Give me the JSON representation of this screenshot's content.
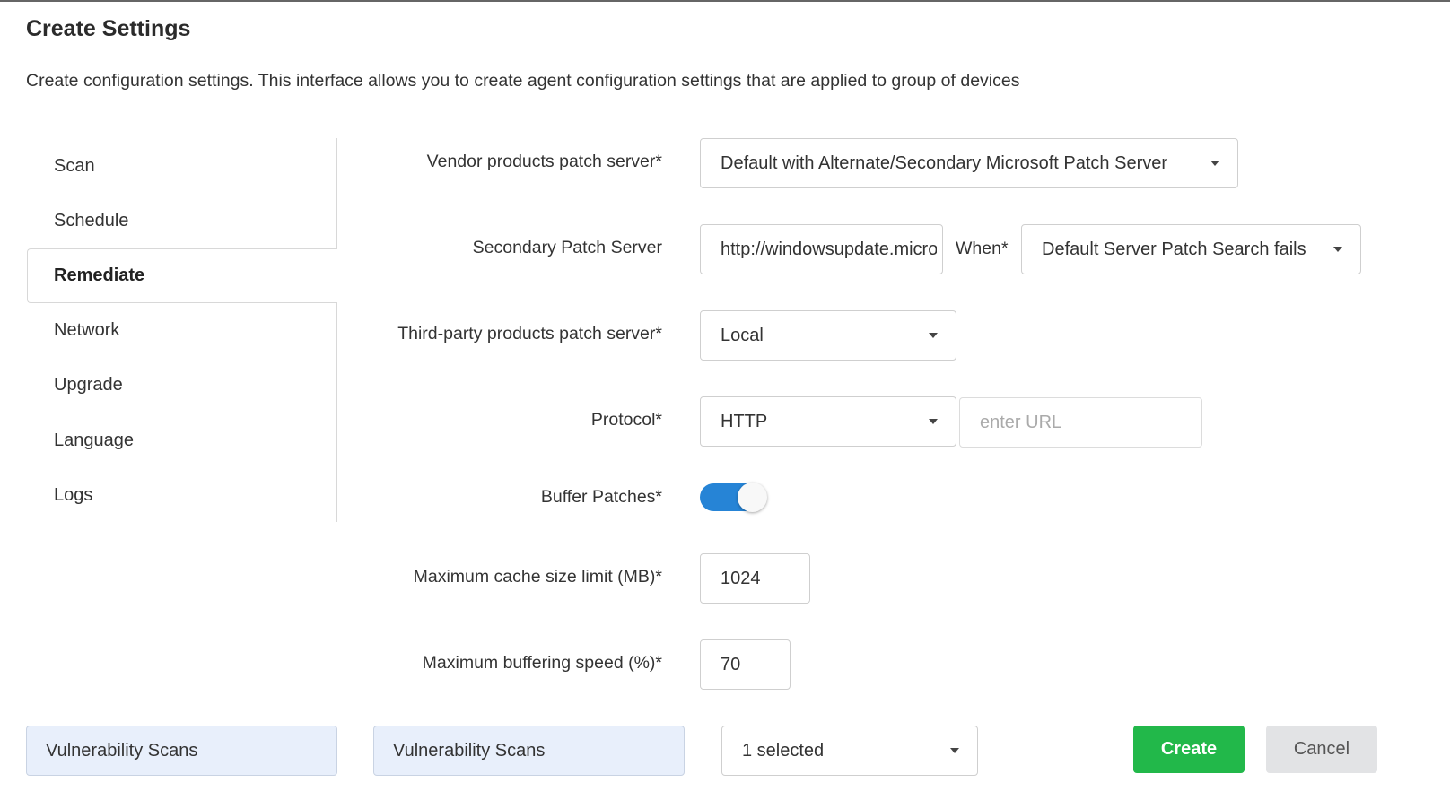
{
  "page": {
    "title": "Create Settings",
    "description": "Create configuration settings. This interface allows you to create agent configuration settings that are applied to group of devices"
  },
  "sidebar": {
    "items": [
      {
        "label": "Scan",
        "active": false
      },
      {
        "label": "Schedule",
        "active": false
      },
      {
        "label": "Remediate",
        "active": true
      },
      {
        "label": "Network",
        "active": false
      },
      {
        "label": "Upgrade",
        "active": false
      },
      {
        "label": "Language",
        "active": false
      },
      {
        "label": "Logs",
        "active": false
      }
    ]
  },
  "form": {
    "vendor_patch_server": {
      "label": "Vendor products patch server*",
      "value": "Default with Alternate/Secondary Microsoft Patch Server"
    },
    "secondary_patch_server": {
      "label": "Secondary Patch Server",
      "value": "http://windowsupdate.microsoft.com",
      "when_label": "When*",
      "when_value": "Default Server Patch Search fails"
    },
    "third_party_patch_server": {
      "label": "Third-party products patch server*",
      "value": "Local"
    },
    "protocol": {
      "label": "Protocol*",
      "value": "HTTP",
      "url_placeholder": "enter URL",
      "url_value": ""
    },
    "buffer_patches": {
      "label": "Buffer Patches*",
      "enabled": true
    },
    "max_cache_size": {
      "label": "Maximum cache size limit (MB)*",
      "value": "1024"
    },
    "max_buffering_speed": {
      "label": "Maximum buffering speed (%)*",
      "value": "70"
    }
  },
  "footer": {
    "chip_1": "Vulnerability Scans",
    "chip_2": "Vulnerability Scans",
    "multi_select": "1 selected",
    "create_label": "Create",
    "cancel_label": "Cancel"
  },
  "colors": {
    "toggle_on": "#2684d6",
    "create_button": "#22b84a",
    "cancel_button": "#e2e3e5",
    "chip_background": "#e8effb"
  }
}
